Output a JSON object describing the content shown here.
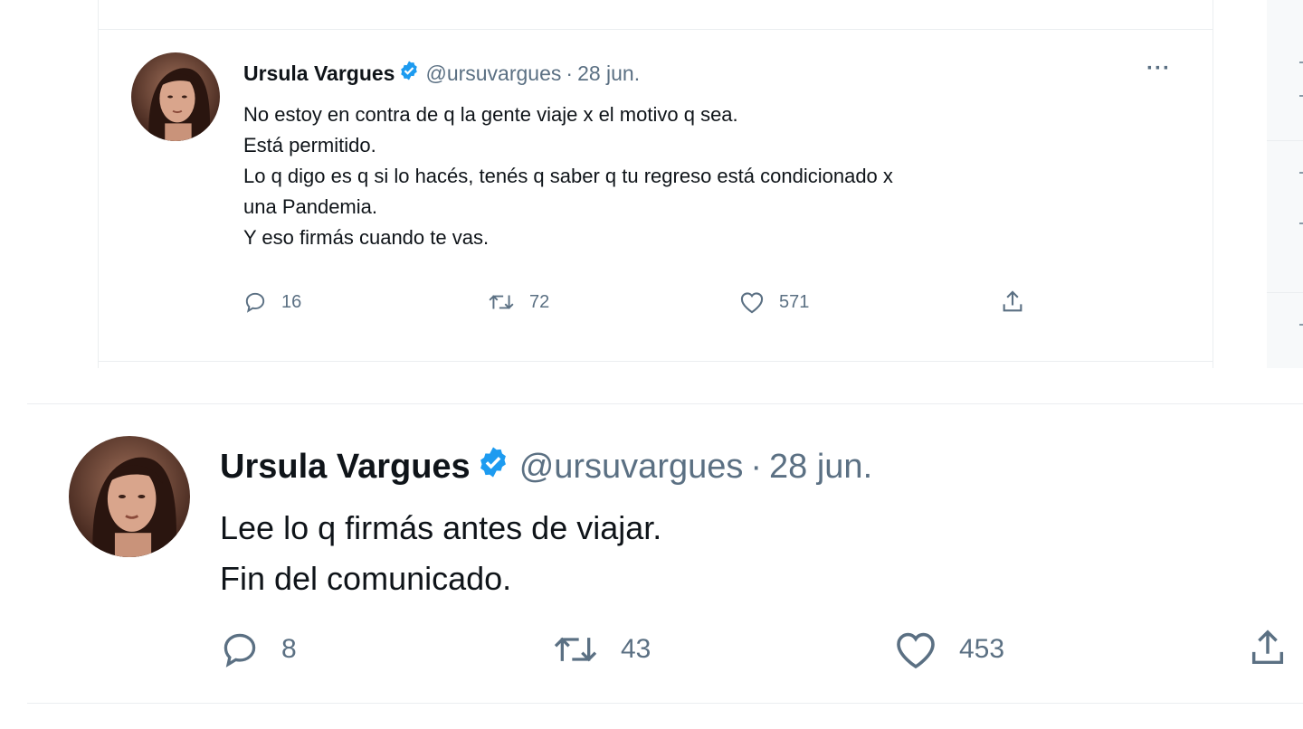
{
  "colors": {
    "text": "#0f1419",
    "secondary": "#5b7083",
    "verified": "#1d9bf0",
    "border": "#ebeef0"
  },
  "tweets": [
    {
      "name": "Ursula Vargues",
      "handle": "@ursuvargues",
      "separator": "·",
      "date": "28 jun.",
      "more": "···",
      "text": "No estoy en contra de q la gente viaje x el motivo q sea.\nEstá permitido.\nLo q digo es q si lo hacés, tenés q saber q tu regreso está condicionado x\nuna Pandemia.\nY eso firmás cuando te vas.",
      "replies": "16",
      "retweets": "72",
      "likes": "571",
      "icons": {
        "reply": "reply-icon",
        "retweet": "retweet-icon",
        "like": "heart-icon",
        "share": "share-icon",
        "verified": "verified-badge-icon"
      }
    },
    {
      "name": "Ursula Vargues",
      "handle": "@ursuvargues",
      "separator": "·",
      "date": "28 jun.",
      "text": "Lee lo q firmás antes de viajar.\nFin del comunicado.",
      "replies": "8",
      "retweets": "43",
      "likes": "453",
      "icons": {
        "reply": "reply-icon",
        "retweet": "retweet-icon",
        "like": "heart-icon",
        "share": "share-icon",
        "verified": "verified-badge-icon"
      }
    }
  ]
}
